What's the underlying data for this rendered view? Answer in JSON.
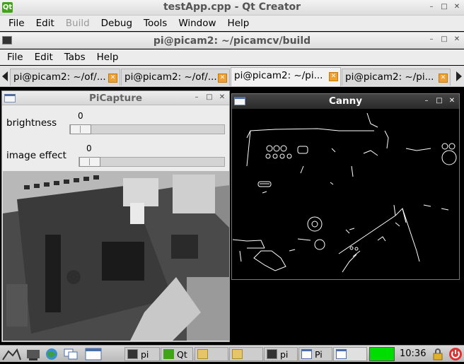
{
  "qt_creator": {
    "title": "testApp.cpp - Qt Creator",
    "logo": "Qt",
    "menu": [
      "File",
      "Edit",
      "Build",
      "Debug",
      "Tools",
      "Window",
      "Help"
    ]
  },
  "terminal": {
    "title": "pi@picam2: ~/picamcv/build",
    "menu": [
      "File",
      "Edit",
      "Tabs",
      "Help"
    ],
    "tabs": [
      "pi@picam2: ~/of/...",
      "pi@picam2: ~/of/...",
      "pi@picam2: ~/pi...",
      "pi@picam2: ~/pi..."
    ]
  },
  "picapture": {
    "title": "PiCapture",
    "brightness_label": "brightness",
    "brightness_value": "0",
    "effect_label": "image effect",
    "effect_value": "0"
  },
  "canny": {
    "title": "Canny"
  },
  "window_buttons": {
    "minimize": "–",
    "maximize": "□",
    "close": "✕"
  },
  "taskbar": {
    "items": [
      "pi",
      "Qt",
      "",
      "",
      "pi",
      "Pi",
      ""
    ],
    "clock": "10:36",
    "cpu_color": "#00dd00"
  },
  "colors": {
    "accent_orange": "#f0a030",
    "canny_bg": "#000000"
  }
}
